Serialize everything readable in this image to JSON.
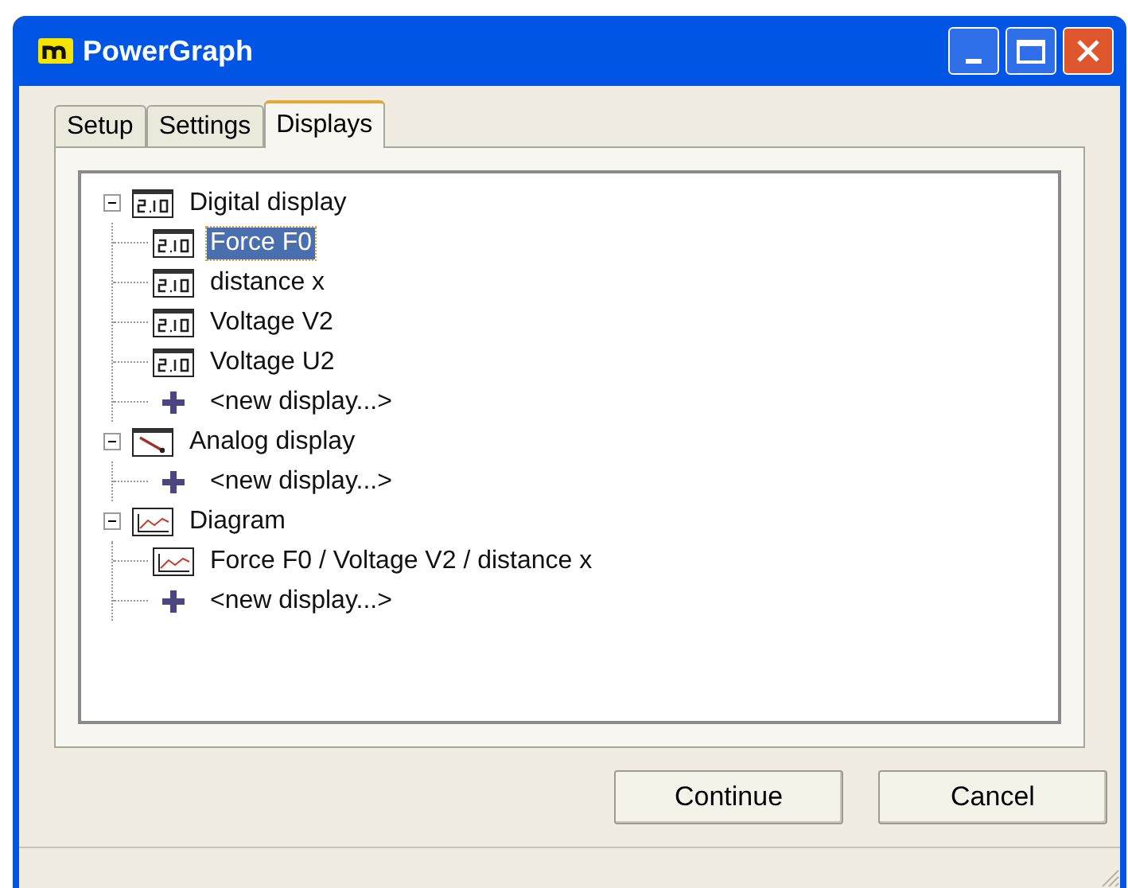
{
  "window": {
    "title": "PowerGraph"
  },
  "tabs": [
    {
      "label": "Setup",
      "selected": false
    },
    {
      "label": "Settings",
      "selected": false
    },
    {
      "label": "Displays",
      "selected": true
    }
  ],
  "tree": [
    {
      "label": "Digital display",
      "kind": "digital",
      "expanded": true,
      "selected": false,
      "children": [
        {
          "label": "Force F0",
          "kind": "digital",
          "selected": true
        },
        {
          "label": "distance x",
          "kind": "digital",
          "selected": false
        },
        {
          "label": "Voltage V2",
          "kind": "digital",
          "selected": false
        },
        {
          "label": "Voltage U2",
          "kind": "digital",
          "selected": false
        },
        {
          "label": "<new display...>",
          "kind": "new",
          "selected": false
        }
      ]
    },
    {
      "label": "Analog display",
      "kind": "analog",
      "expanded": true,
      "selected": false,
      "children": [
        {
          "label": "<new display...>",
          "kind": "new",
          "selected": false
        }
      ]
    },
    {
      "label": "Diagram",
      "kind": "diagram",
      "expanded": true,
      "selected": false,
      "children": [
        {
          "label": "Force F0 / Voltage V2 / distance x",
          "kind": "diagram",
          "selected": false
        },
        {
          "label": "<new display...>",
          "kind": "new",
          "selected": false
        }
      ]
    }
  ],
  "buttons": [
    "Continue",
    "Cancel"
  ]
}
